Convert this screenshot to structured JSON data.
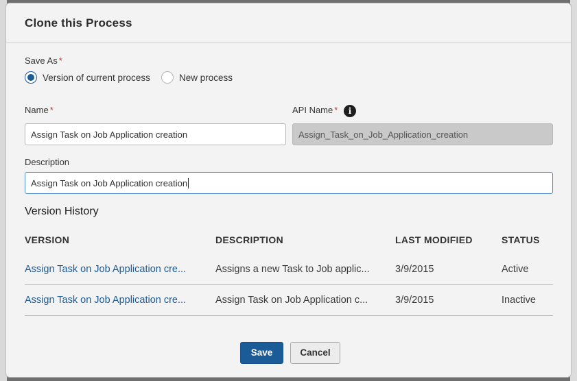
{
  "dialog": {
    "title": "Clone this Process"
  },
  "save_as": {
    "label": "Save As",
    "required_mark": "*",
    "options": [
      {
        "label": "Version of current process",
        "checked": true
      },
      {
        "label": "New process",
        "checked": false
      }
    ]
  },
  "name_field": {
    "label": "Name",
    "required_mark": "*",
    "value": "Assign Task on Job Application creation"
  },
  "api_name_field": {
    "label": "API Name",
    "required_mark": "*",
    "info_icon": "i",
    "value": "Assign_Task_on_Job_Application_creation"
  },
  "description_field": {
    "label": "Description",
    "value": "Assign Task on Job Application creation"
  },
  "version_history": {
    "title": "Version History",
    "columns": [
      "VERSION",
      "DESCRIPTION",
      "LAST MODIFIED",
      "STATUS"
    ],
    "rows": [
      {
        "version": "Assign Task on Job Application cre...",
        "description": "Assigns a new Task to Job applic...",
        "last_modified": "3/9/2015",
        "status": "Active"
      },
      {
        "version": "Assign Task on Job Application cre...",
        "description": "Assign Task on Job Application c...",
        "last_modified": "3/9/2015",
        "status": "Inactive"
      }
    ]
  },
  "footer": {
    "save_label": "Save",
    "cancel_label": "Cancel"
  },
  "colors": {
    "brand": "#1b5b98",
    "required": "#c23934",
    "focus": "#4d8fd0"
  }
}
